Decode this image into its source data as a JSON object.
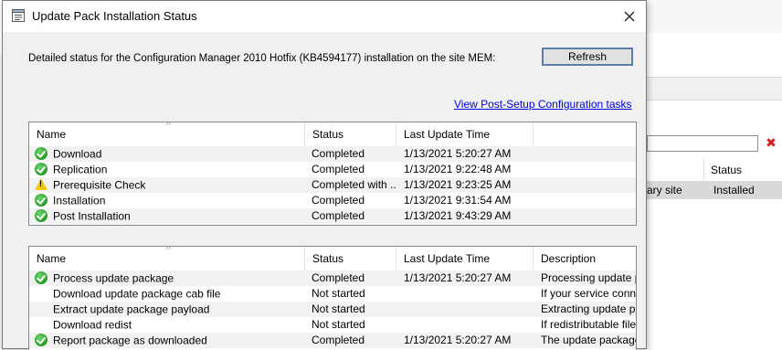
{
  "dialog": {
    "title": "Update Pack Installation Status",
    "detail_text": "Detailed status for the Configuration Manager 2010 Hotfix (KB4594177) installation on the site MEM:",
    "refresh_label": "Refresh",
    "post_setup_link": "View Post-Setup Configuration tasks"
  },
  "top_table": {
    "columns": [
      "Name",
      "Status",
      "Last Update Time"
    ],
    "rows": [
      {
        "icon": "check-icon",
        "name": "Download",
        "status": "Completed",
        "time": "1/13/2021 5:20:27 AM"
      },
      {
        "icon": "check-icon",
        "name": "Replication",
        "status": "Completed",
        "time": "1/13/2021 9:22:48 AM"
      },
      {
        "icon": "warning-icon",
        "name": "Prerequisite Check",
        "status": "Completed with ...",
        "time": "1/13/2021 9:23:25 AM"
      },
      {
        "icon": "check-icon",
        "name": "Installation",
        "status": "Completed",
        "time": "1/13/2021 9:31:54 AM"
      },
      {
        "icon": "check-icon",
        "name": "Post Installation",
        "status": "Completed",
        "time": "1/13/2021 9:43:29 AM"
      }
    ]
  },
  "bottom_table": {
    "columns": [
      "Name",
      "Status",
      "Last Update Time",
      "Description"
    ],
    "rows": [
      {
        "icon": "check-icon",
        "name": "Process update package",
        "status": "Completed",
        "time": "1/13/2021 5:20:27 AM",
        "description": "Processing update pac"
      },
      {
        "icon": "",
        "name": "Download update package cab file",
        "status": "Not started",
        "time": "",
        "description": "If your service connec"
      },
      {
        "icon": "",
        "name": "Extract update package payload",
        "status": "Not started",
        "time": "",
        "description": "Extracting update pac"
      },
      {
        "icon": "",
        "name": "Download redist",
        "status": "Not started",
        "time": "",
        "description": "If redistributable files a"
      },
      {
        "icon": "check-icon",
        "name": "Report package as downloaded",
        "status": "Completed",
        "time": "1/13/2021 5:20:27 AM",
        "description": "The update package l"
      }
    ]
  },
  "background_window": {
    "status_header": "Status",
    "row_site_fragment": "ary site",
    "row_status": "Installed"
  },
  "colors": {
    "link": "#0000ee",
    "check": "#2ea42e",
    "warning": "#f2c811",
    "clear_x": "#d32222"
  }
}
